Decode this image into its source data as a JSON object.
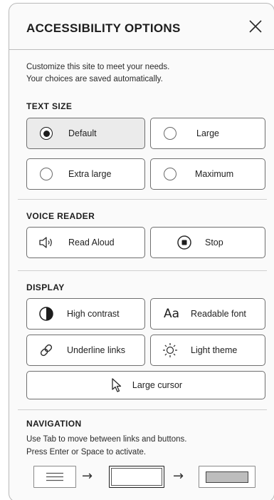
{
  "header": {
    "title": "ACCESSIBILITY OPTIONS"
  },
  "intro": {
    "line1": "Customize this site to meet your needs.",
    "line2": "Your choices are saved automatically."
  },
  "text_size": {
    "title": "TEXT SIZE",
    "options": [
      {
        "label": "Default",
        "selected": true
      },
      {
        "label": "Large",
        "selected": false
      },
      {
        "label": "Extra large",
        "selected": false
      },
      {
        "label": "Maximum",
        "selected": false
      }
    ]
  },
  "voice_reader": {
    "title": "VOICE READER",
    "read_aloud": "Read Aloud",
    "stop": "Stop"
  },
  "display": {
    "title": "DISPLAY",
    "high_contrast": "High contrast",
    "readable_font": "Readable font",
    "readable_font_glyph": "Aa",
    "underline_links": "Underline links",
    "light_theme": "Light theme",
    "large_cursor": "Large cursor"
  },
  "navigation": {
    "title": "NAVIGATION",
    "line1": "Use Tab to move between links and buttons.",
    "line2": "Press Enter or Space to activate.",
    "arrow": "→"
  }
}
